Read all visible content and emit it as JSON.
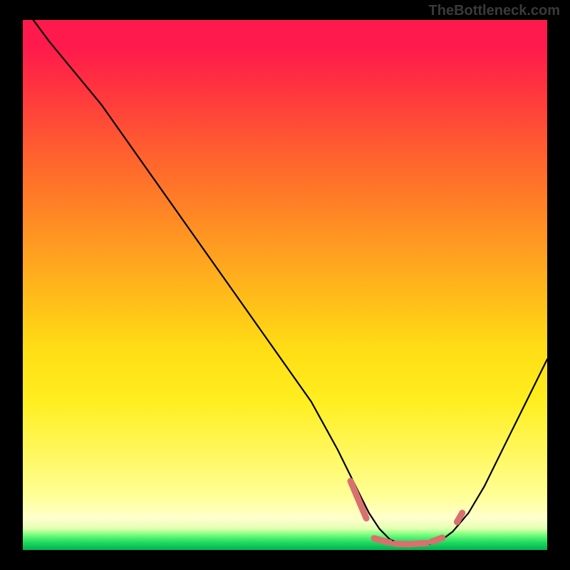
{
  "watermark": "TheBottleneck.com",
  "chart_data": {
    "type": "line",
    "title": "",
    "xlabel": "",
    "ylabel": "",
    "xlim": [
      0,
      100
    ],
    "ylim": [
      0,
      100
    ],
    "series": [
      {
        "name": "bottleneck-curve",
        "x": [
          0,
          2,
          5,
          10,
          15,
          20,
          25,
          30,
          35,
          40,
          45,
          50,
          55,
          60,
          62,
          64,
          66,
          68,
          70,
          72,
          74,
          76,
          78,
          80,
          82,
          85,
          88,
          92,
          96,
          100
        ],
        "values": [
          102,
          100,
          96,
          90,
          84,
          77,
          70,
          63,
          56,
          49,
          42,
          35,
          28,
          19,
          15,
          11,
          7,
          4,
          2,
          1.2,
          1,
          1,
          1.2,
          2,
          3.5,
          7,
          12,
          20,
          28,
          36
        ]
      }
    ],
    "markers": {
      "name": "highlight-segments",
      "color": "#d97070",
      "segments": [
        {
          "x1": 62.5,
          "y1": 13,
          "x2": 65.5,
          "y2": 6
        },
        {
          "x1": 67.0,
          "y1": 2.2,
          "x2": 70.0,
          "y2": 1.4
        },
        {
          "x1": 71.0,
          "y1": 1.2,
          "x2": 73.0,
          "y2": 1.1
        },
        {
          "x1": 73.5,
          "y1": 1.1,
          "x2": 77.0,
          "y2": 1.3
        },
        {
          "x1": 78.0,
          "y1": 1.6,
          "x2": 80.0,
          "y2": 2.3
        },
        {
          "x1": 82.8,
          "y1": 5.3,
          "x2": 83.8,
          "y2": 7.0
        }
      ]
    },
    "gradient_stops": [
      {
        "pos": 0.0,
        "color": "#ff1a4d"
      },
      {
        "pos": 0.5,
        "color": "#ffcc18"
      },
      {
        "pos": 0.92,
        "color": "#ffff99"
      },
      {
        "pos": 0.97,
        "color": "#80ff80"
      },
      {
        "pos": 1.0,
        "color": "#00b050"
      }
    ]
  }
}
